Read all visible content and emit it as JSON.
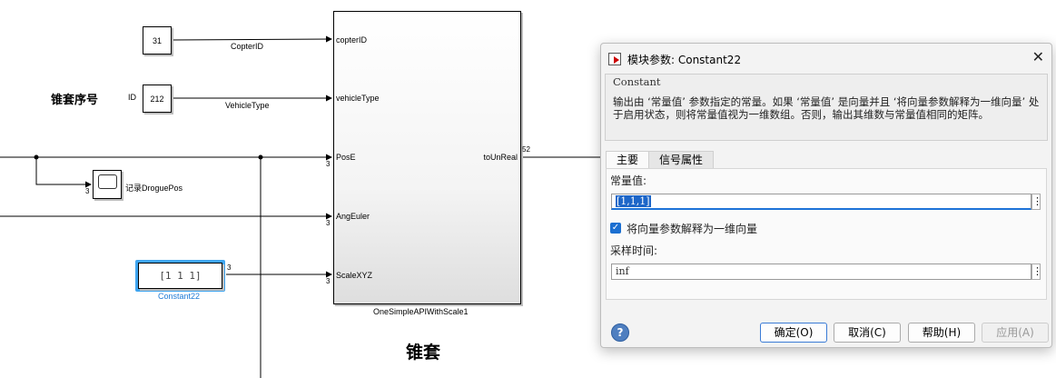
{
  "model": {
    "const31": "31",
    "const31_signal": "CopterID",
    "droguenum_label": "锥套序号",
    "id_label": "ID",
    "const212": "212",
    "const212_signal": "VehicleType",
    "scope_label": "记录DroguePos",
    "const22_value": "[1 1 1]",
    "const22_name": "Constant22",
    "width_3": "3",
    "subsystem": {
      "ports_in": [
        "copterID",
        "vehicleType",
        "PosE",
        "AngEuler",
        "ScaleXYZ"
      ],
      "port_out": "toUnReal",
      "out_width": "52",
      "name": "OneSimpleAPIWithScale1"
    },
    "section_title": "锥套"
  },
  "dialog": {
    "title": "模块参数: Constant22",
    "group_title": "Constant",
    "description": "输出由 ‘常量值’ 参数指定的常量。如果 ‘常量值’ 是向量并且 ‘将向量参数解释为一维向量’ 处于启用状态，则将常量值视为一维数组。否则，输出其维数与常量值相同的矩阵。",
    "tabs": [
      "主要",
      "信号属性"
    ],
    "constant_label": "常量值:",
    "constant_value": "[1,1,1]",
    "checkbox_label": "将向量参数解释为一维向量",
    "checkbox_checked": true,
    "sample_label": "采样时间:",
    "sample_value": "inf",
    "buttons": {
      "ok": "确定(O)",
      "cancel": "取消(C)",
      "help": "帮助(H)",
      "apply": "应用(A)"
    },
    "help_icon": "?",
    "close_icon": "✕",
    "kebab": "⋮",
    "check_glyph": "✓"
  },
  "colors": {
    "selection": "#1d66c8",
    "block_highlight": "#3fa5f0",
    "label_blue": "#1f7bd6"
  }
}
